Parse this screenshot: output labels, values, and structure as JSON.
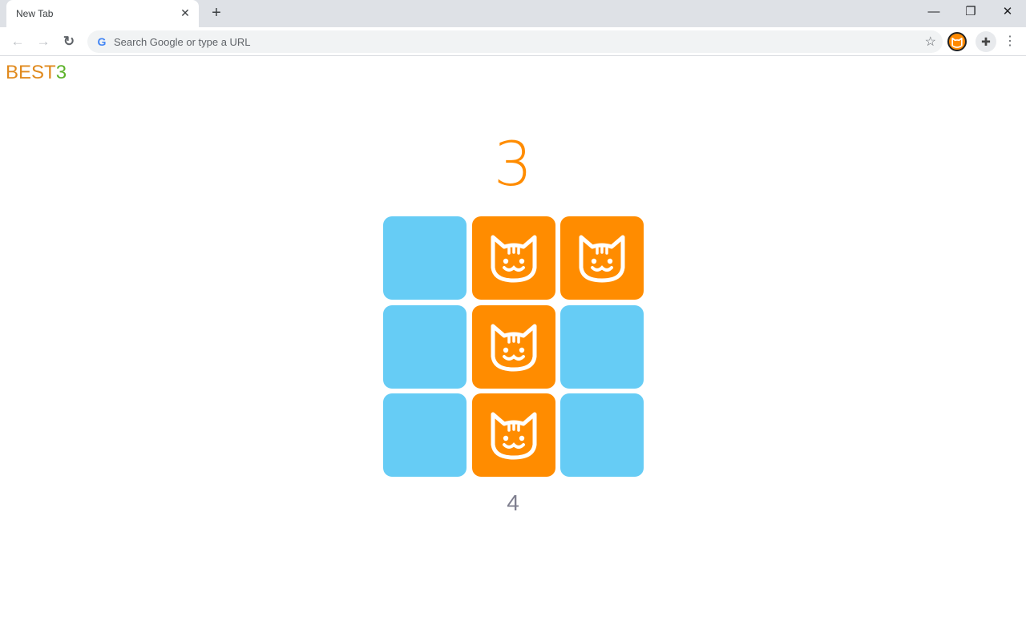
{
  "browser": {
    "tab_title": "New Tab",
    "tab_close_glyph": "✕",
    "new_tab_glyph": "+",
    "window_controls": {
      "minimize": "—",
      "restore": "❐",
      "close": "✕"
    },
    "back_glyph": "←",
    "forward_glyph": "→",
    "reload_glyph": "↻",
    "omnibox_icon": "G",
    "omnibox_placeholder": "Search Google or type a URL",
    "bookmark_glyph": "☆",
    "extensions_glyph": "✚",
    "menu_glyph": "⋮"
  },
  "game": {
    "best_label": "BEST",
    "best_value": "3",
    "score": "3",
    "moves": "4",
    "colors": {
      "blue": "#66ccf5",
      "orange": "#ff8c00",
      "best_label": "#e08a1e",
      "best_value": "#5db22a"
    },
    "tiles": [
      {
        "state": "blue",
        "cat": false
      },
      {
        "state": "orange",
        "cat": true
      },
      {
        "state": "orange",
        "cat": true
      },
      {
        "state": "blue",
        "cat": false
      },
      {
        "state": "orange",
        "cat": true
      },
      {
        "state": "blue",
        "cat": false
      },
      {
        "state": "blue",
        "cat": false
      },
      {
        "state": "orange",
        "cat": true
      },
      {
        "state": "blue",
        "cat": false
      }
    ]
  }
}
